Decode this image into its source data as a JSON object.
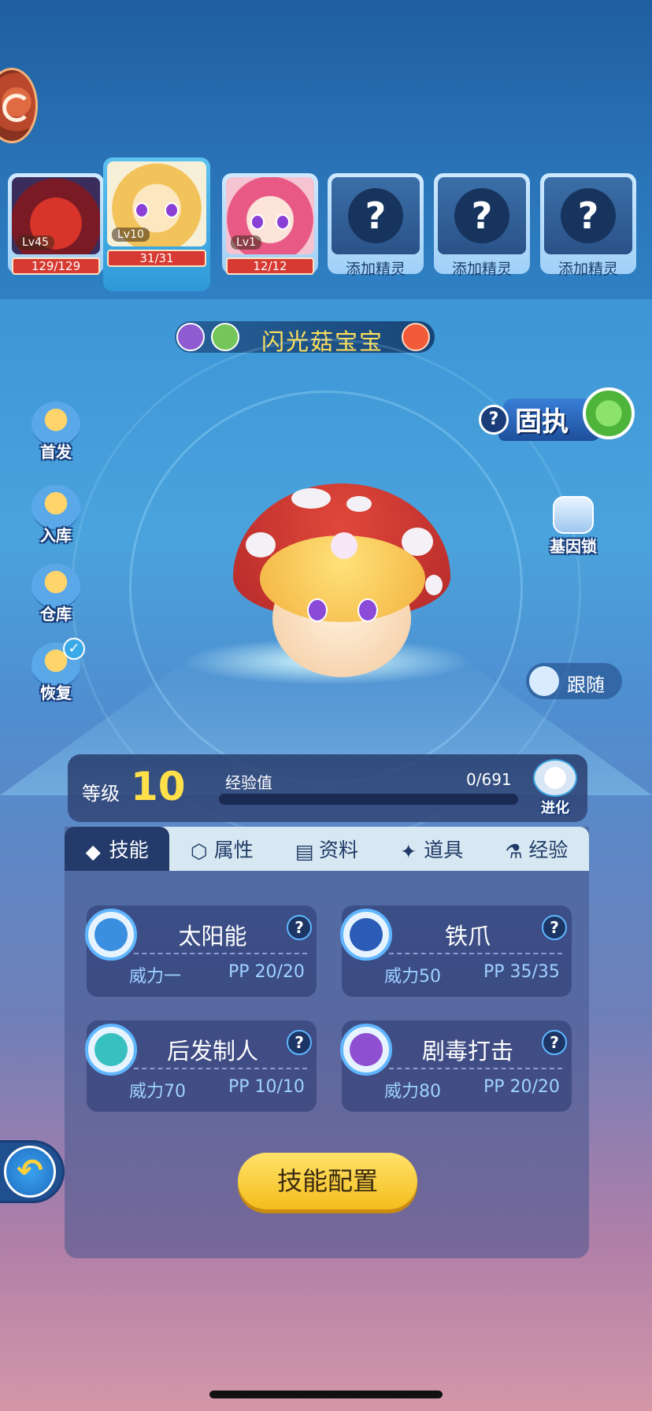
{
  "team": [
    {
      "level": "Lv45",
      "hp": "129/129"
    },
    {
      "level": "Lv10",
      "hp": "31/31"
    },
    {
      "level": "Lv1",
      "hp": "12/12"
    }
  ],
  "add_slot_label": "添加精灵",
  "pet": {
    "name": "闪光菇宝宝",
    "nature": "固执",
    "level_label": "等级",
    "level": "10",
    "exp_label": "经验值",
    "exp": "0/691",
    "exp_progress": 0
  },
  "side_buttons": [
    "首发",
    "入库",
    "仓库",
    "恢复"
  ],
  "gene_lock": "基因锁",
  "follow": "跟随",
  "evolve": "进化",
  "tabs": [
    "技能",
    "属性",
    "资料",
    "道具",
    "经验"
  ],
  "skills": [
    {
      "name": "太阳能",
      "power": "威力一",
      "pp": "PP 20/20",
      "badge_color": "#3a8fe0"
    },
    {
      "name": "铁爪",
      "power": "威力50",
      "pp": "PP 35/35",
      "badge_color": "#2b5cb8"
    },
    {
      "name": "后发制人",
      "power": "威力70",
      "pp": "PP 10/10",
      "badge_color": "#38c0c0"
    },
    {
      "name": "剧毒打击",
      "power": "威力80",
      "pp": "PP 20/20",
      "badge_color": "#8e4fd0"
    }
  ],
  "config_button": "技能配置",
  "help_glyph": "?",
  "back_glyph": "↶"
}
